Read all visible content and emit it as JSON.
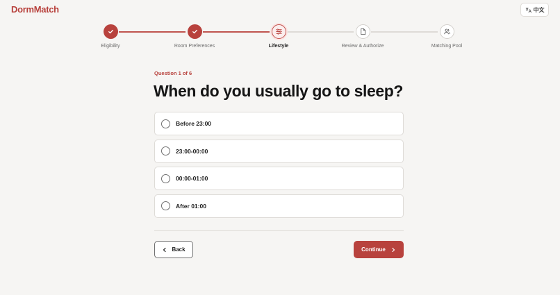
{
  "app": {
    "brand": "DormMatch",
    "language_button": "中文"
  },
  "stepper": {
    "steps": [
      {
        "label": "Eligibility",
        "state": "done",
        "icon": "check-icon"
      },
      {
        "label": "Room Preferences",
        "state": "done",
        "icon": "check-icon"
      },
      {
        "label": "Lifestyle",
        "state": "current",
        "icon": "sliders-icon"
      },
      {
        "label": "Review & Authorize",
        "state": "pending",
        "icon": "document-icon"
      },
      {
        "label": "Matching Pool",
        "state": "pending",
        "icon": "people-icon"
      }
    ]
  },
  "question": {
    "counter": "Question 1 of 6",
    "title": "When do you usually go to sleep?",
    "options": [
      "Before 23:00",
      "23:00-00:00",
      "00:00-01:00",
      "After 01:00"
    ]
  },
  "nav": {
    "back_label": "Back",
    "continue_label": "Continue"
  },
  "colors": {
    "accent": "#b8423d",
    "background": "#f6f5f3"
  }
}
